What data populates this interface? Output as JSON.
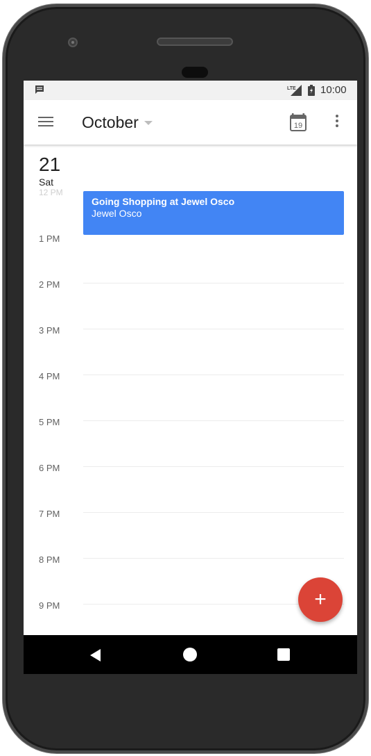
{
  "device": {
    "icons": [
      "camera-icon",
      "speaker-grille",
      "proximity-sensor"
    ]
  },
  "status_bar": {
    "time": "10:00",
    "network": "LTE",
    "icons": [
      "notification-icon",
      "lte-signal-icon",
      "battery-icon"
    ]
  },
  "app_bar": {
    "month": "October",
    "today_day": "19",
    "icons": [
      "menu-icon",
      "dropdown-caret-icon",
      "calendar-today-icon",
      "more-vert-icon"
    ]
  },
  "day": {
    "number": "21",
    "weekday": "Sat"
  },
  "hours": [
    "12 PM",
    "1 PM",
    "2 PM",
    "3 PM",
    "4 PM",
    "5 PM",
    "6 PM",
    "7 PM",
    "8 PM",
    "9 PM"
  ],
  "event": {
    "title": "Going Shopping at Jewel Osco",
    "location": "Jewel Osco",
    "color": "#4285f4"
  },
  "fab": {
    "label": "+",
    "color": "#db4437"
  },
  "nav_bar": {
    "icons": [
      "back-icon",
      "home-icon",
      "recents-icon"
    ]
  }
}
